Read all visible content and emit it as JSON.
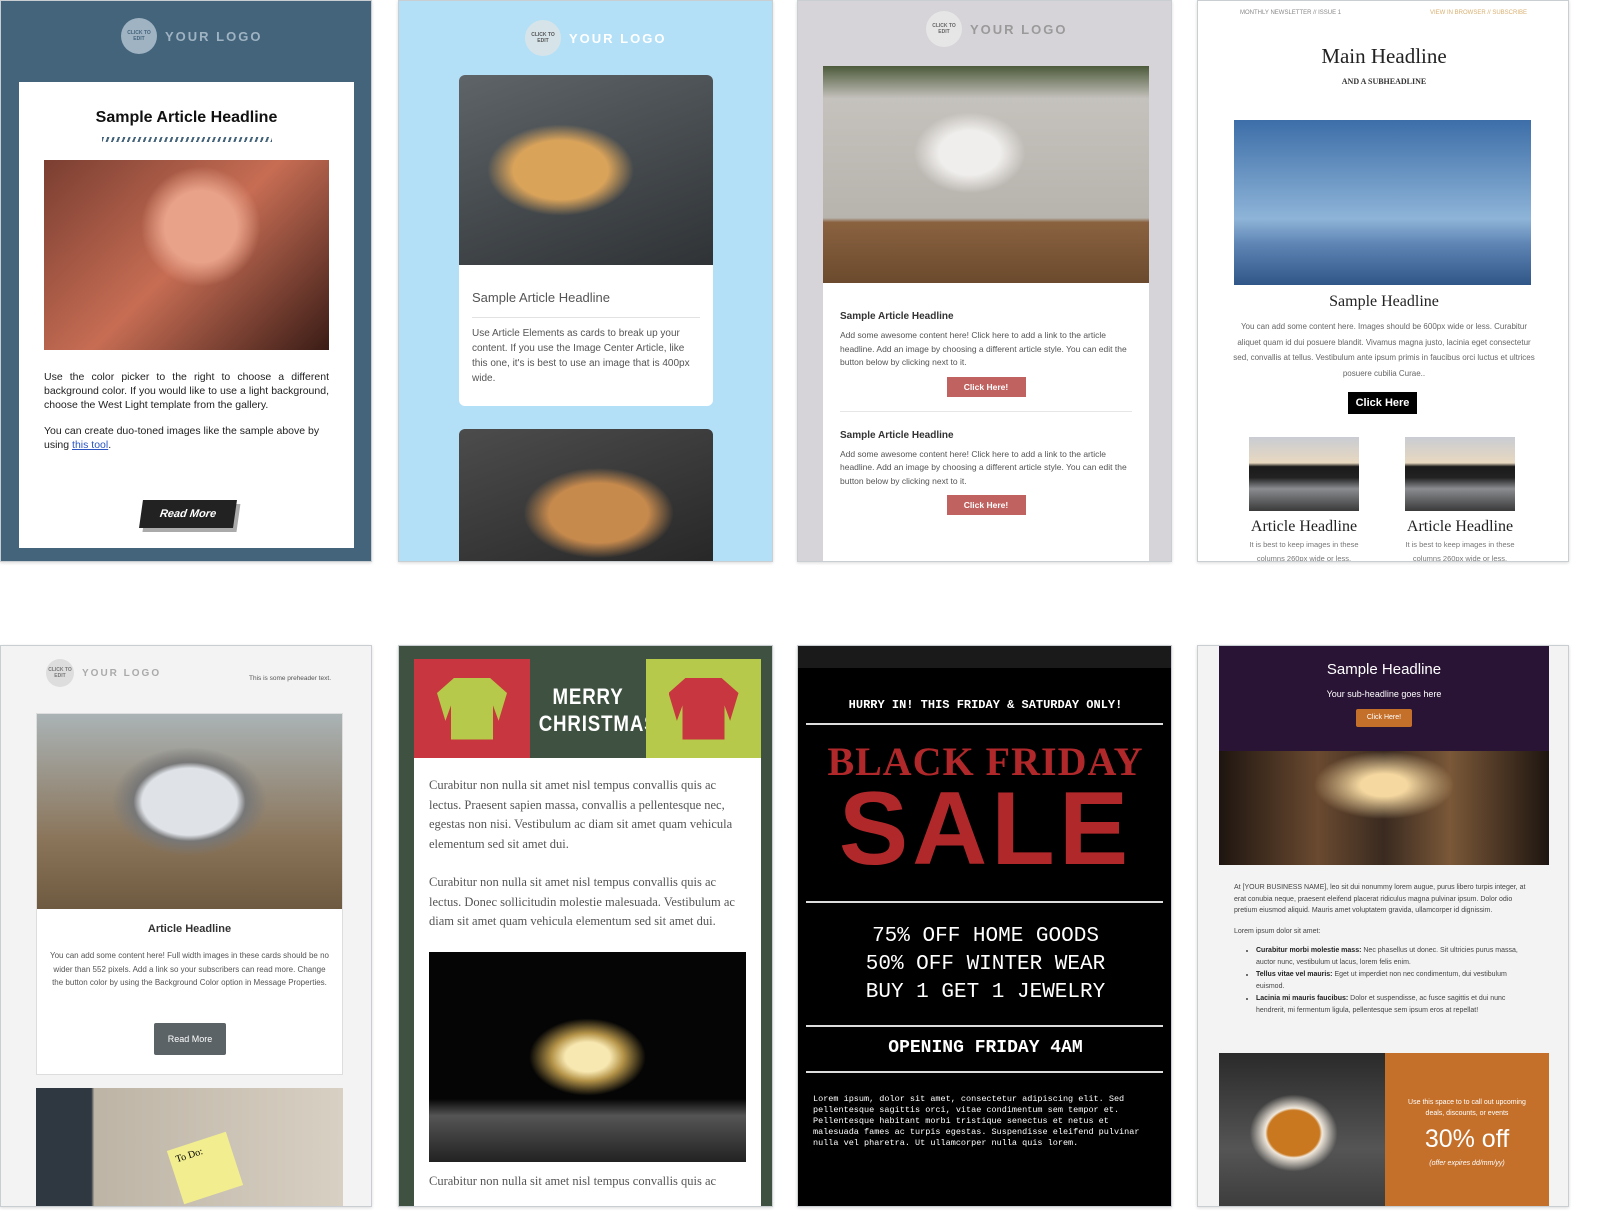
{
  "templates": [
    {
      "logo": "YOUR LOGO",
      "logo_badge": "CLICK TO EDIT",
      "headline": "Sample Article Headline",
      "body1": "Use the color picker to the right to choose a different background color. If you would like to use a light background, choose the West Light template from the gallery.",
      "body2_pre": "You can create duo-toned images like the sample above by using ",
      "body2_link": "this tool",
      "body2_post": ".",
      "button": "Read More",
      "accent": "#44647c"
    },
    {
      "logo": "YOUR LOGO",
      "logo_badge": "CLICK TO EDIT",
      "headline": "Sample Article Headline",
      "body": "Use Article Elements as cards to break up your content. If you use the Image Center Article, like this one, it's is best to use an image that is 400px wide.",
      "accent": "#b3e0f7"
    },
    {
      "logo": "YOUR LOGO",
      "logo_badge": "CLICK TO EDIT",
      "articles": [
        {
          "headline": "Sample Article Headline",
          "body": "Add some awesome content here! Click here to add a link to the article headline. Add an image by choosing a different article style. You can edit the button below by clicking next to it.",
          "button": "Click Here!"
        },
        {
          "headline": "Sample Article Headline",
          "body": "Add some awesome content here! Click here to add a link to the article headline. Add an image by choosing a different article style. You can edit the button below by clicking next to it.",
          "button": "Click Here!"
        }
      ],
      "accent": "#c0625f"
    },
    {
      "preheader_left": "MONTHLY NEWSLETTER // ISSUE 1",
      "preheader_right": "VIEW IN BROWSER // SUBSCRIBE",
      "headline": "Main Headline",
      "subheadline": "AND A SUBHEADLINE",
      "section_headline": "Sample Headline",
      "body": "You can add some content here. Images should be 600px wide or less. Curabitur aliquet quam id dui posuere blandit. Vivamus magna justo, lacinia eget consectetur sed, convallis at tellus. Vestibulum ante ipsum primis in faucibus orci luctus et ultrices posuere cubilia Curae..",
      "button": "Click Here",
      "columns": [
        {
          "headline": "Article Headline",
          "body": "It is best to keep images in these columns 260px wide or less."
        },
        {
          "headline": "Article Headline",
          "body": "It is best to keep images in these columns 260px wide or less."
        }
      ]
    },
    {
      "logo": "YOUR LOGO",
      "logo_badge": "CLICK TO EDIT",
      "preheader": "This is some preheader text.",
      "headline": "Article Headline",
      "body": "You can add some content here! Full width images in these cards should be no wider than 552 pixels. Add a link so your subscribers can read more. Change the button color by using the Background Color option in Message Properties.",
      "button": "Read More",
      "note_text": "To Do:"
    },
    {
      "title_line1": "MERRY",
      "title_line2": "CHRISTMAS",
      "para1": "Curabitur non nulla sit amet nisl tempus convallis quis ac lectus. Praesent sapien massa, convallis a pellentesque nec, egestas non nisi. Vestibulum ac diam sit amet quam vehicula elementum sed sit amet dui.",
      "para2": "Curabitur non nulla sit amet nisl tempus convallis quis ac lectus. Donec sollicitudin molestie malesuada. Vestibulum ac diam sit amet quam vehicula elementum sed sit amet dui.",
      "para3": "Curabitur non nulla sit amet nisl tempus convallis quis ac",
      "red": "#c8363f",
      "green": "#b6c94a",
      "dark": "#3f5140"
    },
    {
      "banner": "HURRY IN! THIS FRIDAY & SATURDAY ONLY!",
      "title1": "BLACK FRIDAY",
      "title2": "SALE",
      "offers": [
        "75% OFF HOME GOODS",
        "50% OFF WINTER WEAR",
        "BUY 1 GET 1 JEWELRY"
      ],
      "opening": "OPENING FRIDAY 4AM",
      "body": "Lorem ipsum, dolor sit amet, consectetur adipiscing elit. Sed pellentesque sagittis orci, vitae condimentum sem tempor et. Pellentesque habitant morbi tristique senectus et netus et malesuada fames ac turpis egestas. Suspendisse eleifend pulvinar nulla vel pharetra. Ut ullamcorper nulla quis lorem.",
      "red": "#b1282b"
    },
    {
      "headline": "Sample Headline",
      "subheadline": "Your sub-headline goes here",
      "button": "Click Here!",
      "intro": "At [YOUR BUSINESS NAME], leo sit dui nonummy lorem augue, purus libero turpis integer, at erat conubia neque, praesent eleifend placerat ridiculus magna pulvinar ipsum. Dolor odio pretium eiusmod aliquid. Mauris amet voluptatem gravida, ullamcorper id dignissim.",
      "list_intro": "Lorem ipsum dolor sit amet:",
      "bullets": [
        {
          "bold": "Curabitur morbi molestie mass:",
          "text": " Nec phasellus ut donec. Sit ultricies purus massa, auctor nunc, vestibulum ut lacus, lorem felis enim."
        },
        {
          "bold": "Tellus vitae vel mauris:",
          "text": " Eget ut imperdiet non nec condimentum, dui vestibulum euismod."
        },
        {
          "bold": "Lacinia mi mauris faucibus:",
          "text": " Dolor et suspendisse, ac fusce sagittis et dui nunc hendrerit, mi fermentum ligula, pellentesque sem ipsum eros at repellat!"
        }
      ],
      "promo_text": "Use this space to to call out upcoming deals, discounts, or events",
      "promo_big": "30% off",
      "promo_small": "(offer expires dd/mm/yy)",
      "purple": "#2a1436",
      "orange": "#c4702a"
    }
  ]
}
